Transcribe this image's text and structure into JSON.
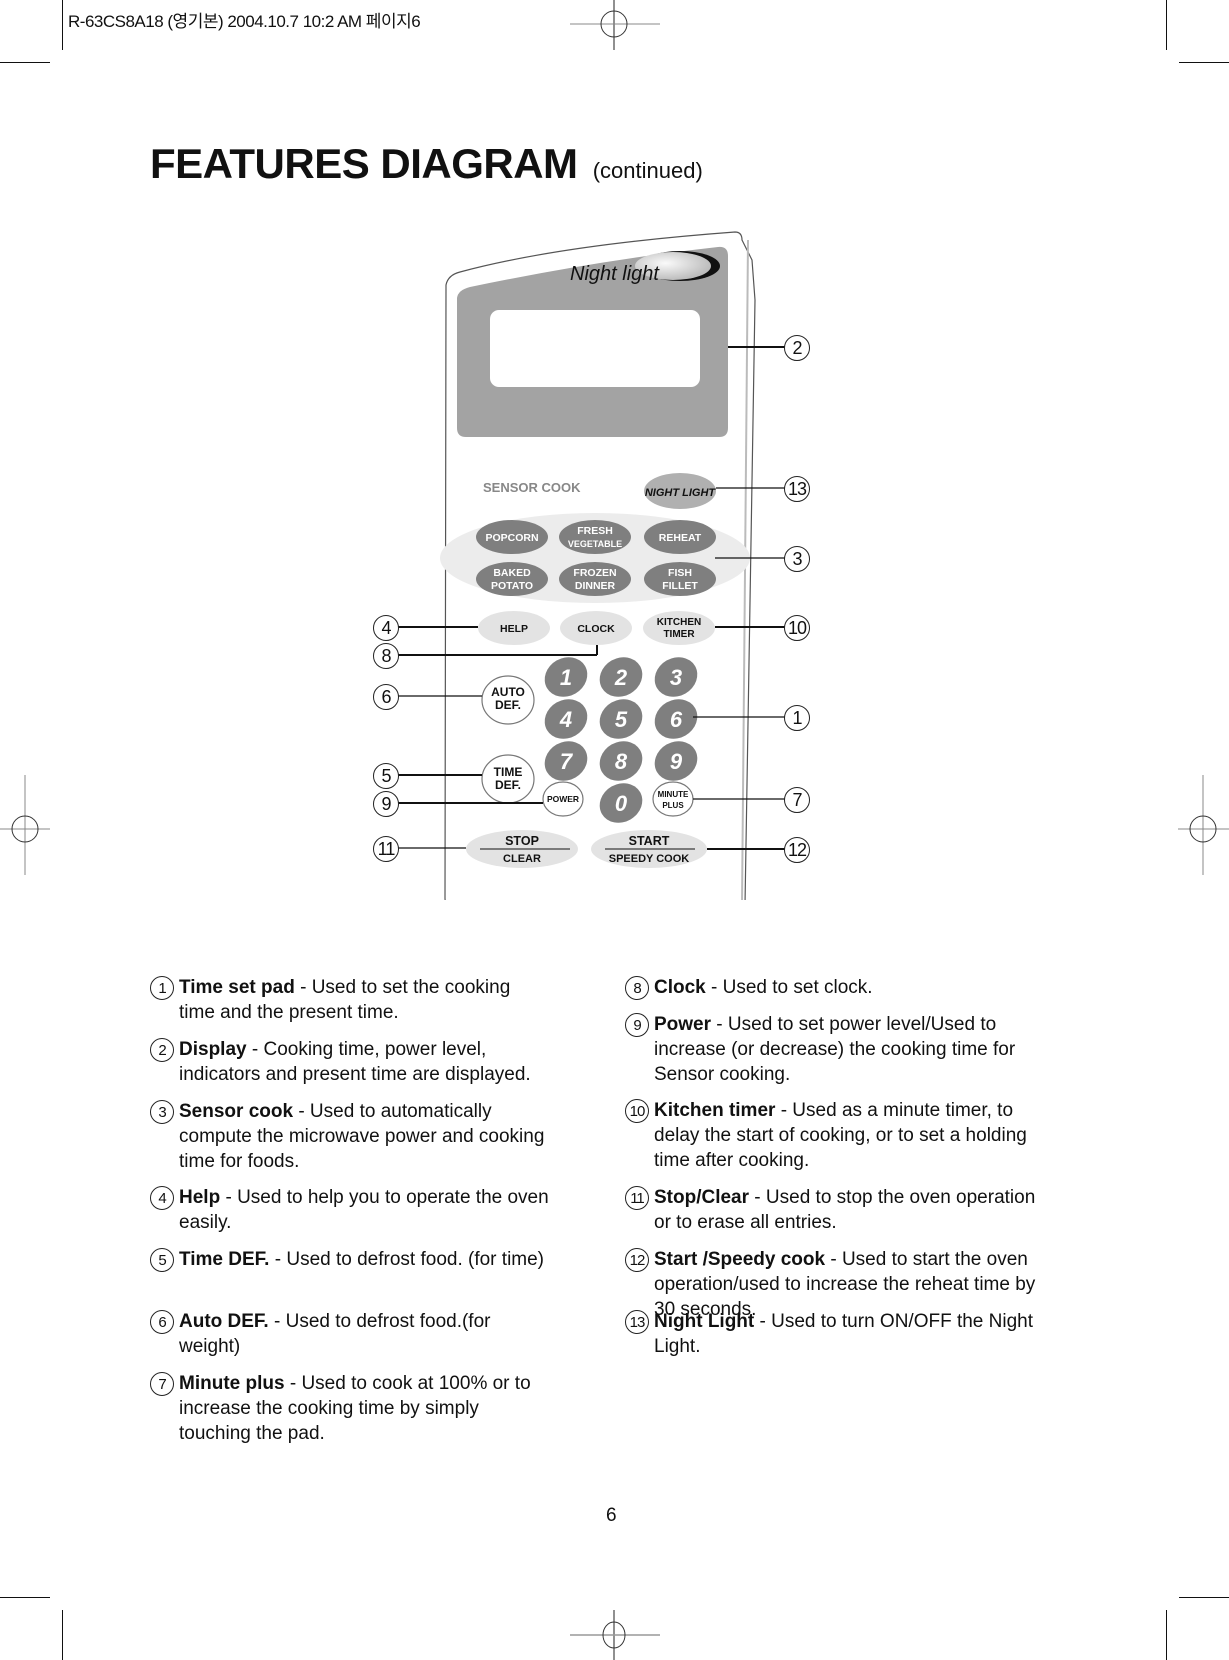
{
  "print_header": "R-63CS8A18 (영기본)  2004.10.7 10:2 AM 페이지6",
  "page": {
    "title": "FEATURES DIAGRAM",
    "title_suffix": "(continued)",
    "page_number": "6"
  },
  "panel": {
    "brand_label": "Night light",
    "sensor_label": "SENSOR COOK",
    "buttons": {
      "night_light": "NIGHT LIGHT",
      "popcorn": "POPCORN",
      "fresh": "FRESH",
      "vegetable": "VEGETABLE",
      "reheat": "REHEAT",
      "baked": "BAKED",
      "potato": "POTATO",
      "frozen": "FROZEN",
      "dinner": "DINNER",
      "fish": "FISH",
      "fillet": "FILLET",
      "help": "HELP",
      "clock": "CLOCK",
      "kitchen": "KITCHEN",
      "timer": "TIMER",
      "auto": "AUTO",
      "auto_def": "DEF.",
      "time": "TIME",
      "time_def": "DEF.",
      "power": "POWER",
      "minute": "MINUTE",
      "plus": "PLUS",
      "stop": "STOP",
      "clear": "CLEAR",
      "start": "START",
      "speedy_cook": "SPEEDY COOK"
    },
    "digits": [
      "1",
      "2",
      "3",
      "4",
      "5",
      "6",
      "7",
      "8",
      "9",
      "0"
    ]
  },
  "callouts": {
    "c1": "1",
    "c2": "2",
    "c3": "3",
    "c4": "4",
    "c5": "5",
    "c6": "6",
    "c7": "7",
    "c8": "8",
    "c9": "9",
    "c10": "10",
    "c11": "11",
    "c12": "12",
    "c13": "13"
  },
  "features": [
    {
      "num": "1",
      "name": "Time set pad",
      "desc": " - Used to set the cooking time and the present time."
    },
    {
      "num": "2",
      "name": "Display",
      "desc": " - Cooking time, power level, indicators and present time are displayed."
    },
    {
      "num": "3",
      "name": "Sensor cook",
      "desc": " - Used to automatically compute the microwave power and cooking time for foods."
    },
    {
      "num": "4",
      "name": "Help",
      "desc": " - Used to help you to operate the oven easily."
    },
    {
      "num": "5",
      "name": "Time DEF.",
      "desc": " - Used to defrost food. (for time)"
    },
    {
      "num": "6",
      "name": "Auto DEF.",
      "desc": " - Used to defrost food.(for weight)"
    },
    {
      "num": "7",
      "name": "Minute plus",
      "desc": " - Used to cook at 100% or to increase the cooking time by simply touching the pad."
    },
    {
      "num": "8",
      "name": "Clock",
      "desc": " - Used to set clock."
    },
    {
      "num": "9",
      "name": "Power",
      "desc": " - Used to set power level/Used to increase (or decrease) the cooking time for Sensor cooking."
    },
    {
      "num": "10",
      "name": "Kitchen timer",
      "desc": " - Used as a minute timer, to delay the start of cooking, or to set a holding time after cooking."
    },
    {
      "num": "11",
      "name": "Stop/Clear",
      "desc": " - Used to stop the oven operation or to erase all entries."
    },
    {
      "num": "12",
      "name": "Start /Speedy cook",
      "desc": " - Used to start the oven operation/used to increase the reheat time by 30 seconds."
    },
    {
      "num": "13",
      "name": "Night Light",
      "desc": " - Used to turn ON/OFF the Night Light."
    }
  ]
}
